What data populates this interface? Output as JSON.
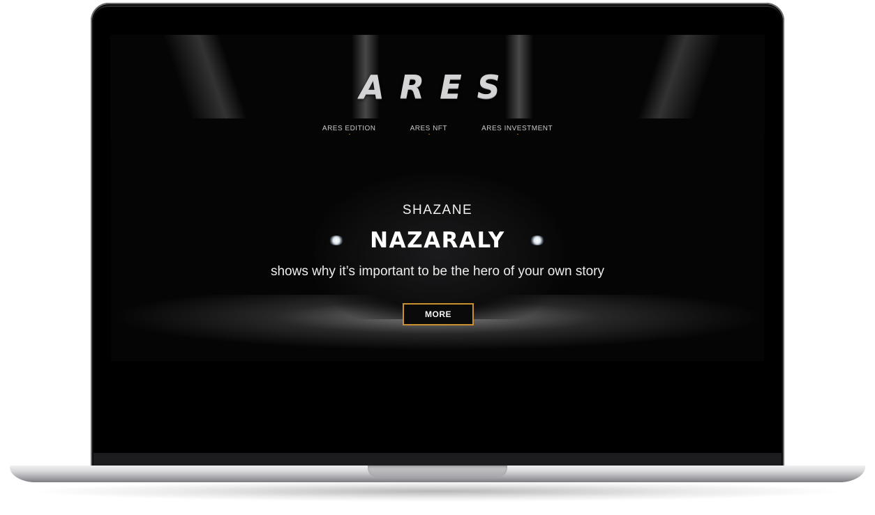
{
  "site": {
    "logo_text": "ARES"
  },
  "nav": {
    "items": [
      {
        "label": "ARES EDITION"
      },
      {
        "label": "ARES NFT"
      },
      {
        "label": "ARES INVESTMENT"
      }
    ]
  },
  "hero": {
    "kicker": "SHAZANE",
    "title": "NAZARALY",
    "subtitle": "shows why it’s important to be the hero of your own story",
    "button_label": "MORE"
  },
  "colors": {
    "accent": "#c8902f",
    "background": "#000000",
    "text": "#ffffff"
  }
}
